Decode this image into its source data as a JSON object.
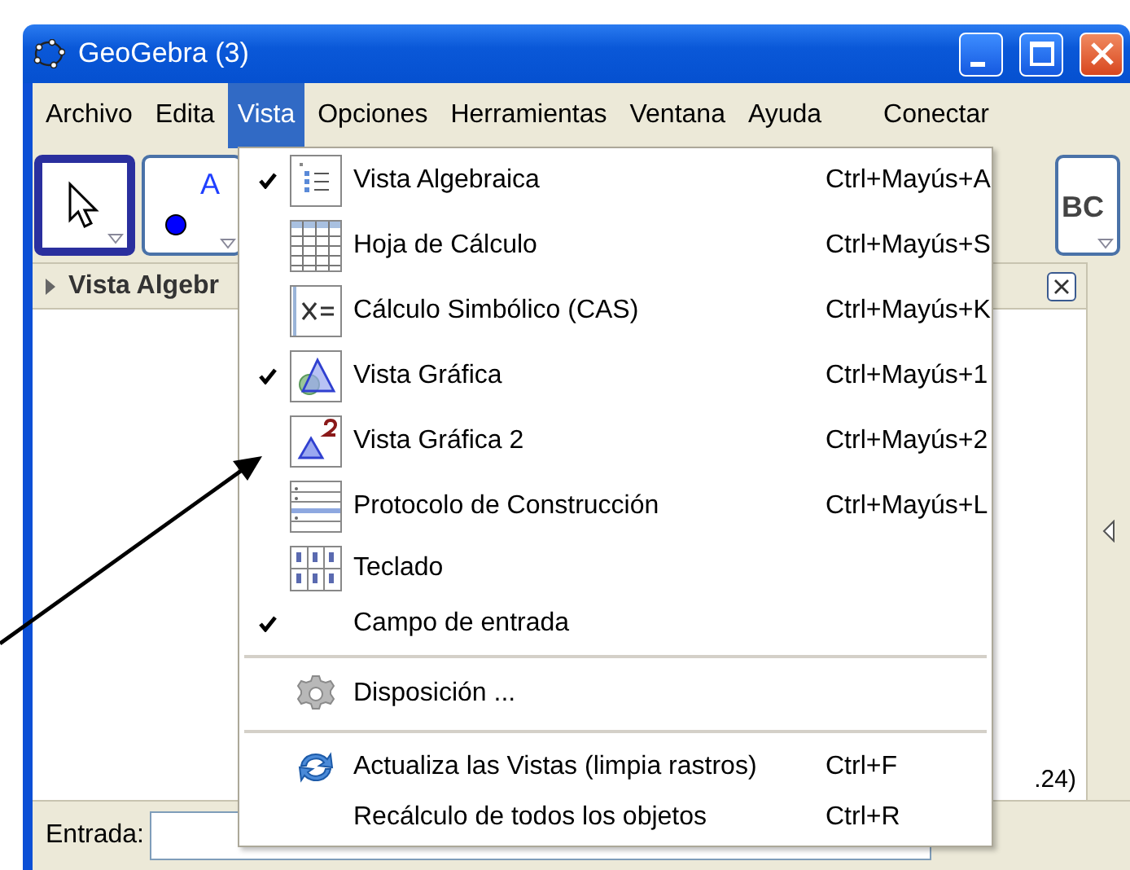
{
  "window": {
    "title": "GeoGebra (3)"
  },
  "menu_bar": [
    {
      "label": "Archivo",
      "selected": false
    },
    {
      "label": "Edita",
      "selected": false
    },
    {
      "label": "Vista",
      "selected": true
    },
    {
      "label": "Opciones",
      "selected": false
    },
    {
      "label": "Herramientas",
      "selected": false
    },
    {
      "label": "Ventana",
      "selected": false
    },
    {
      "label": "Ayuda",
      "selected": false
    },
    {
      "label": "Conectar",
      "selected": false
    }
  ],
  "toolbar": [
    {
      "selected": true
    },
    {
      "label": "A",
      "selected": false
    },
    {
      "label": "BC",
      "selected": false
    }
  ],
  "algebra_panel": {
    "title": "Vista Algebr",
    "partial_text": ".24)"
  },
  "input_bar": {
    "label": "Entrada:"
  },
  "view_menu": [
    {
      "kind": "item",
      "label": "Vista Algebraica",
      "shortcut": "Ctrl+Mayús+A",
      "checked": true
    },
    {
      "kind": "item",
      "label": "Hoja de Cálculo",
      "shortcut": "Ctrl+Mayús+S",
      "checked": false
    },
    {
      "kind": "item",
      "label": "Cálculo Simbólico (CAS)",
      "shortcut": "Ctrl+Mayús+K",
      "checked": false
    },
    {
      "kind": "item",
      "label": "Vista Gráfica",
      "shortcut": "Ctrl+Mayús+1",
      "checked": true
    },
    {
      "kind": "item",
      "label": "Vista Gráfica 2",
      "shortcut": "Ctrl+Mayús+2",
      "checked": false
    },
    {
      "kind": "item",
      "label": "Protocolo de Construcción",
      "shortcut": "Ctrl+Mayús+L",
      "checked": false
    },
    {
      "kind": "item",
      "label": "Teclado",
      "checked": false
    },
    {
      "kind": "item",
      "label": "Campo de entrada",
      "checked": true
    },
    {
      "kind": "separator"
    },
    {
      "kind": "item",
      "label": "Disposición ..."
    },
    {
      "kind": "separator"
    },
    {
      "kind": "item",
      "label": "Actualiza las Vistas (limpia rastros)",
      "shortcut": "Ctrl+F"
    },
    {
      "kind": "item",
      "label": "Recálculo de todos los objetos",
      "shortcut": "Ctrl+R"
    }
  ]
}
